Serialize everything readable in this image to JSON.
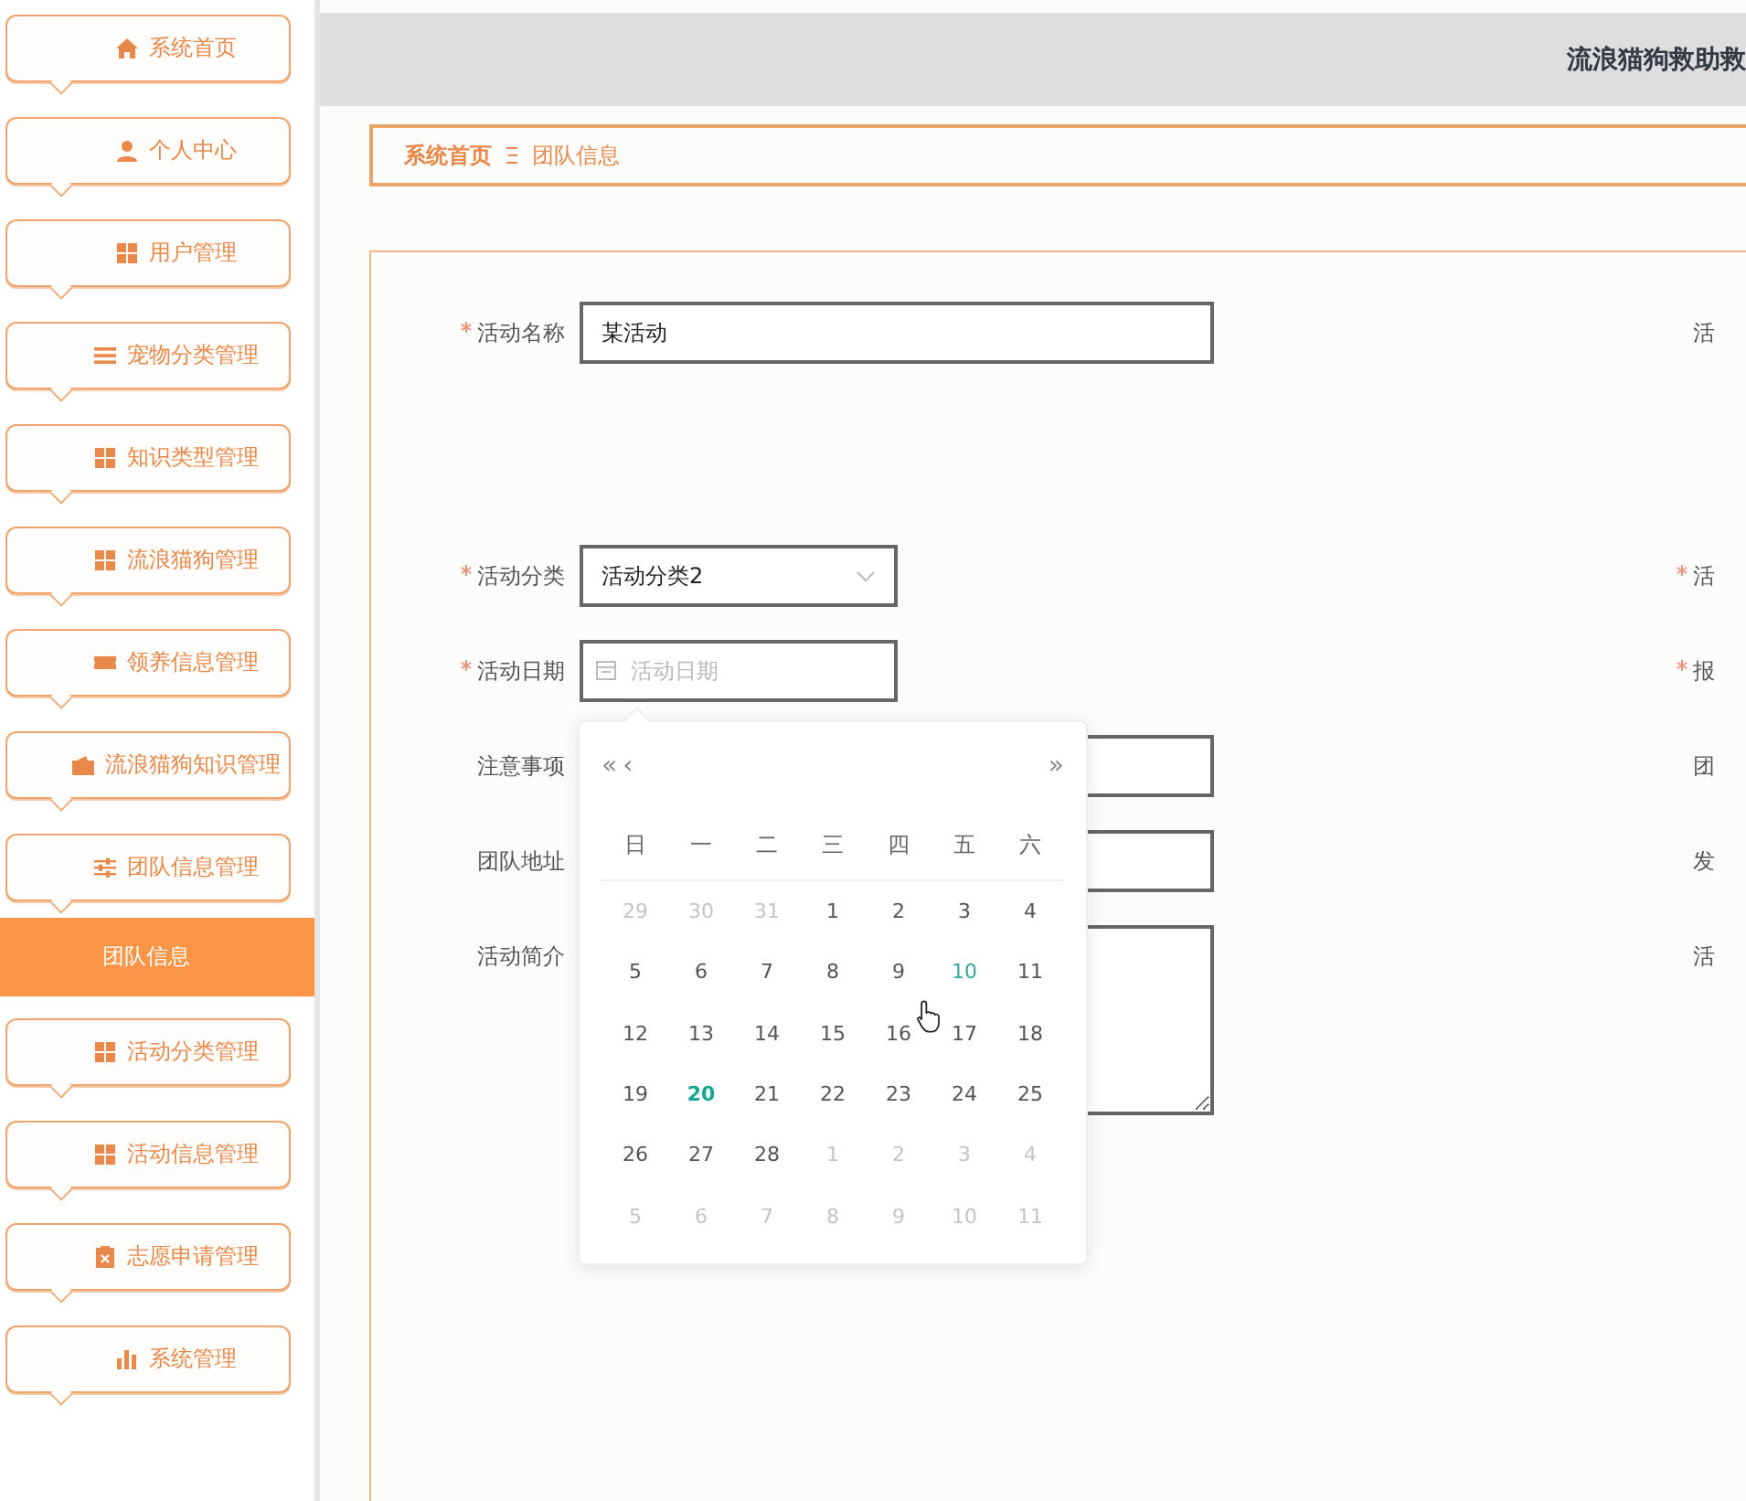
{
  "sidebar": {
    "items": [
      {
        "label": "系统首页",
        "kind": "home"
      },
      {
        "label": "个人中心",
        "kind": "user"
      },
      {
        "label": "用户管理",
        "kind": "grid"
      },
      {
        "label": "宠物分类管理",
        "kind": "list"
      },
      {
        "label": "知识类型管理",
        "kind": "grid"
      },
      {
        "label": "流浪猫狗管理",
        "kind": "grid"
      },
      {
        "label": "领养信息管理",
        "kind": "ticket"
      },
      {
        "label": "流浪猫狗知识管理",
        "kind": "wallet"
      },
      {
        "label": "团队信息管理",
        "kind": "sliders",
        "expanded": true,
        "children": [
          {
            "label": "团队信息",
            "selected": true
          }
        ]
      },
      {
        "label": "活动分类管理",
        "kind": "grid"
      },
      {
        "label": "活动信息管理",
        "kind": "grid"
      },
      {
        "label": "志愿申请管理",
        "kind": "clipboard"
      },
      {
        "label": "系统管理",
        "kind": "chart"
      }
    ]
  },
  "header": {
    "title": "流浪猫狗救助救"
  },
  "breadcrumb": [
    {
      "label": "系统首页",
      "kind": "link"
    },
    {
      "label": "团队信息",
      "kind": "current"
    }
  ],
  "form": {
    "rows": [
      {
        "left": {
          "label": "活动名称",
          "required": true,
          "kind": "input",
          "value": "某活动"
        },
        "right": {
          "label": "活",
          "required": false
        }
      },
      {
        "left": {
          "label": "活动分类",
          "required": true,
          "kind": "select",
          "value": "活动分类2"
        },
        "right": {
          "label": "活",
          "required": true
        }
      },
      {
        "left": {
          "label": "活动日期",
          "required": true,
          "kind": "date",
          "placeholder": "活动日期"
        },
        "right": {
          "label": "报",
          "required": true
        }
      },
      {
        "left": {
          "label": "注意事项",
          "required": false,
          "kind": "input"
        },
        "right": {
          "label": "团",
          "required": false
        }
      },
      {
        "left": {
          "label": "团队地址",
          "required": false,
          "kind": "input"
        },
        "right": {
          "label": "发",
          "required": false
        }
      },
      {
        "left": {
          "label": "活动简介",
          "required": false,
          "kind": "textarea"
        },
        "right": {
          "label": "活",
          "required": false
        }
      }
    ]
  },
  "datepicker": {
    "nav_left": [
      "«",
      "‹"
    ],
    "nav_right": [
      "»"
    ],
    "weekdays": [
      "日",
      "一",
      "二",
      "三",
      "四",
      "五",
      "六"
    ],
    "weeks": [
      [
        {
          "day": "29",
          "kind": "other"
        },
        {
          "day": "30",
          "kind": "other"
        },
        {
          "day": "31",
          "kind": "other"
        },
        {
          "day": "1",
          "kind": "normal"
        },
        {
          "day": "2",
          "kind": "normal"
        },
        {
          "day": "3",
          "kind": "normal"
        },
        {
          "day": "4",
          "kind": "normal"
        }
      ],
      [
        {
          "day": "5",
          "kind": "normal"
        },
        {
          "day": "6",
          "kind": "normal"
        },
        {
          "day": "7",
          "kind": "normal"
        },
        {
          "day": "8",
          "kind": "normal"
        },
        {
          "day": "9",
          "kind": "normal"
        },
        {
          "day": "10",
          "kind": "hover"
        },
        {
          "day": "11",
          "kind": "normal"
        }
      ],
      [
        {
          "day": "12",
          "kind": "normal"
        },
        {
          "day": "13",
          "kind": "normal"
        },
        {
          "day": "14",
          "kind": "normal"
        },
        {
          "day": "15",
          "kind": "normal"
        },
        {
          "day": "16",
          "kind": "normal"
        },
        {
          "day": "17",
          "kind": "normal"
        },
        {
          "day": "18",
          "kind": "normal"
        }
      ],
      [
        {
          "day": "19",
          "kind": "normal"
        },
        {
          "day": "20",
          "kind": "today"
        },
        {
          "day": "21",
          "kind": "normal"
        },
        {
          "day": "22",
          "kind": "normal"
        },
        {
          "day": "23",
          "kind": "normal"
        },
        {
          "day": "24",
          "kind": "normal"
        },
        {
          "day": "25",
          "kind": "normal"
        }
      ],
      [
        {
          "day": "26",
          "kind": "normal"
        },
        {
          "day": "27",
          "kind": "normal"
        },
        {
          "day": "28",
          "kind": "normal"
        },
        {
          "day": "1",
          "kind": "other"
        },
        {
          "day": "2",
          "kind": "other"
        },
        {
          "day": "3",
          "kind": "other"
        },
        {
          "day": "4",
          "kind": "other"
        }
      ],
      [
        {
          "day": "5",
          "kind": "other"
        },
        {
          "day": "6",
          "kind": "other"
        },
        {
          "day": "7",
          "kind": "other"
        },
        {
          "day": "8",
          "kind": "other"
        },
        {
          "day": "9",
          "kind": "other"
        },
        {
          "day": "10",
          "kind": "other"
        },
        {
          "day": "11",
          "kind": "other"
        }
      ]
    ]
  }
}
